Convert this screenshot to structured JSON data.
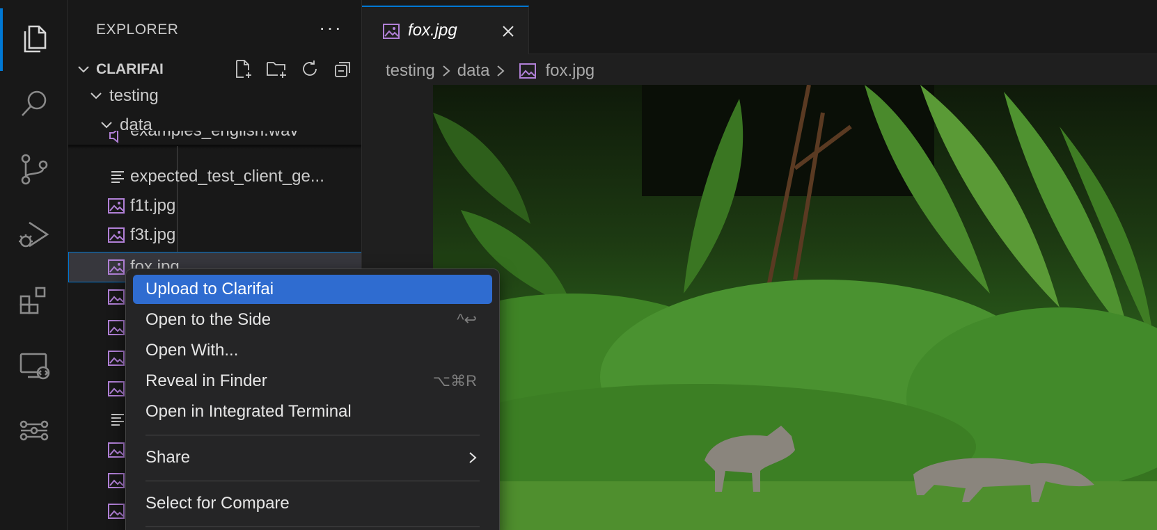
{
  "sidebar": {
    "title": "EXPLORER",
    "more_actions": "···",
    "section_title": "CLARIFAI",
    "tree": [
      {
        "label": "testing"
      },
      {
        "label": "data"
      },
      {
        "label": "examples_english.wav"
      },
      {
        "label": "expected_test_client_ge..."
      },
      {
        "label": "f1t.jpg"
      },
      {
        "label": "f3t.jpg"
      },
      {
        "label": "fox.jpg"
      }
    ]
  },
  "editor": {
    "tab_label": "fox.jpg",
    "breadcrumb": [
      "testing",
      "data",
      "fox.jpg"
    ]
  },
  "context_menu": {
    "items": [
      {
        "label": "Upload to Clarifai",
        "shortcut": ""
      },
      {
        "label": "Open to the Side",
        "shortcut": "^↩"
      },
      {
        "label": "Open With...",
        "shortcut": ""
      },
      {
        "label": "Reveal in Finder",
        "shortcut": "⌥⌘R"
      },
      {
        "label": "Open in Integrated Terminal",
        "shortcut": ""
      },
      {
        "label": "Share",
        "shortcut": ""
      },
      {
        "label": "Select for Compare",
        "shortcut": ""
      }
    ]
  },
  "colors": {
    "accent": "#0078d4",
    "menu_highlight": "#2f6cd0",
    "image_icon": "#b180d7"
  }
}
